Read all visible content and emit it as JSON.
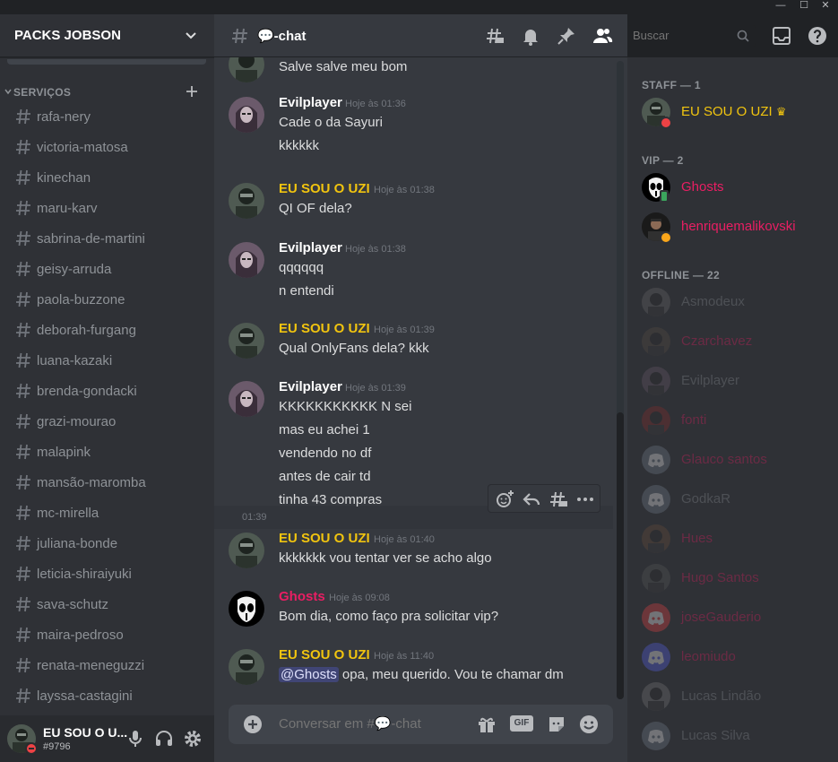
{
  "window_controls": {
    "minimize": "—",
    "maximize": "☐",
    "close": "✕"
  },
  "server": {
    "name": "PACKS JOBSON",
    "category": "SERVIÇOS",
    "channels": [
      "rafa-nery",
      "victoria-matosa",
      "kinechan",
      "maru-karv",
      "sabrina-de-martini",
      "geisy-arruda",
      "paola-buzzone",
      "deborah-furgang",
      "luana-kazaki",
      "brenda-gondacki",
      "grazi-mourao",
      "malapink",
      "mansão-maromba",
      "mc-mirella",
      "juliana-bonde",
      "leticia-shiraiyuki",
      "sava-schutz",
      "maira-pedroso",
      "renata-meneguzzi",
      "layssa-castagini"
    ]
  },
  "user": {
    "name": "EU SOU O U...",
    "tag": "#9796"
  },
  "channel": {
    "name": "💬-chat"
  },
  "search": {
    "placeholder": "Buscar"
  },
  "messages": {
    "top_line": "Salve salve meu bom",
    "groups": [
      {
        "author": "Evilplayer",
        "time": "Hoje às 01:36",
        "lines": [
          "Cade o da Sayuri",
          "kkkkkk"
        ]
      },
      {
        "author": "EU SOU O UZI",
        "time": "Hoje às 01:38",
        "lines": [
          "QI OF dela?"
        ]
      },
      {
        "author": "Evilplayer",
        "time": "Hoje às 01:38",
        "lines": [
          "qqqqqq",
          "n entendi"
        ]
      },
      {
        "author": "EU SOU O UZI",
        "time": "Hoje às 01:39",
        "lines": [
          "Qual OnlyFans dela? kkk"
        ]
      },
      {
        "author": "Evilplayer",
        "time": "Hoje às 01:39",
        "lines": [
          "KKKKKKKKKKK N sei",
          "mas eu achei 1",
          "vendendo no df",
          "antes de cair td",
          "tinha 43 compras"
        ]
      },
      {
        "author": "EU SOU O UZI",
        "time": "Hoje às 01:40",
        "lines": [
          "kkkkkkk vou tentar ver se acho algo"
        ]
      },
      {
        "author": "Ghosts",
        "time": "Hoje às 09:08",
        "lines": [
          "Bom dia, como faço pra solicitar vip?"
        ]
      },
      {
        "author": "EU SOU O UZI",
        "time": "Hoje às 11:40",
        "mention": "@Ghosts",
        "lines": [
          " opa, meu querido. Vou te chamar dm"
        ]
      }
    ],
    "hover_time": "01:39"
  },
  "composer": {
    "placeholder": "Conversar em #💬-chat",
    "gif_label": "GIF"
  },
  "members": {
    "staff_label": "STAFF — 1",
    "vip_label": "VIP — 2",
    "offline_label": "OFFLINE — 22",
    "staff": [
      {
        "name": "EU SOU O UZI",
        "badge": "♛"
      }
    ],
    "vip": [
      {
        "name": "Ghosts"
      },
      {
        "name": "henriquemalikovski"
      }
    ],
    "offline": [
      {
        "name": "Asmodeux"
      },
      {
        "name": "Czarchavez"
      },
      {
        "name": "Evilplayer"
      },
      {
        "name": "fonti"
      },
      {
        "name": "Glauco santos"
      },
      {
        "name": "GodkaR"
      },
      {
        "name": "Hues"
      },
      {
        "name": "Hugo Santos"
      },
      {
        "name": "joseGauderio"
      },
      {
        "name": "leomiudo"
      },
      {
        "name": "Lucas Lindão"
      },
      {
        "name": "Lucas Silva"
      }
    ]
  },
  "colors": {
    "uzi": "#f1c40f",
    "ghosts": "#e91e63",
    "henrique": "#e91e63",
    "white": "#ffffff",
    "offline_pink": "#e91e63",
    "offline_gray": "#8e9297"
  }
}
